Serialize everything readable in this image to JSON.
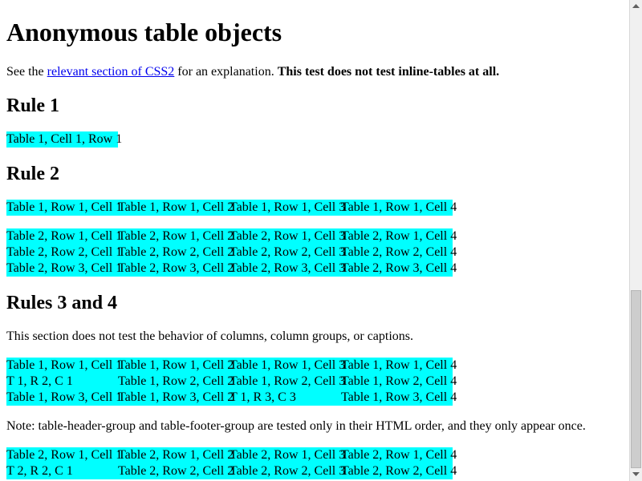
{
  "page": {
    "title": "Anonymous table objects",
    "intro": {
      "prefix": "See the ",
      "link": "relevant section of CSS2",
      "middle": " for an explanation. ",
      "bold": "This test does not test inline-tables at all."
    }
  },
  "rule1": {
    "heading": "Rule 1",
    "table": [
      "Table 1, Cell 1, Row 1"
    ]
  },
  "rule2": {
    "heading": "Rule 2",
    "table1": [
      [
        "Table 1, Row 1, Cell 1",
        "Table 1, Row 1, Cell 2",
        "Table 1, Row 1, Cell 3",
        "Table 1, Row 1, Cell 4"
      ]
    ],
    "table2": [
      [
        "Table 2, Row 1, Cell 1",
        "Table 2, Row 1, Cell 2",
        "Table 2, Row 1, Cell 3",
        "Table 2, Row 1, Cell 4"
      ],
      [
        "Table 2, Row 2, Cell 1",
        "Table 2, Row 2, Cell 2",
        "Table 2, Row 2, Cell 3",
        "Table 2, Row 2, Cell 4"
      ],
      [
        "Table 2, Row 3, Cell 1",
        "Table 2, Row 3, Cell 2",
        "Table 2, Row 3, Cell 3",
        "Table 2, Row 3, Cell 4"
      ]
    ]
  },
  "rules34": {
    "heading": "Rules 3 and 4",
    "description": "This section does not test the behavior of columns, column groups, or captions.",
    "table1": [
      [
        "Table 1, Row 1, Cell 1",
        "Table 1, Row 1, Cell 2",
        "Table 1, Row 1, Cell 3",
        "Table 1, Row 1, Cell 4"
      ],
      [
        "T 1, R 2, C 1",
        "Table 1, Row 2, Cell 2",
        "Table 1, Row 2, Cell 3",
        "Table 1, Row 2, Cell 4"
      ],
      [
        "Table 1, Row 3, Cell 1",
        "Table 1, Row 3, Cell 2",
        "T 1, R 3, C 3",
        "Table 1, Row 3, Cell 4"
      ]
    ],
    "note": "Note: table-header-group and table-footer-group are tested only in their HTML order, and they only appear once.",
    "table2": [
      [
        "Table 2, Row 1, Cell 1",
        "Table 2, Row 1, Cell 2",
        "Table 2, Row 1, Cell 3",
        "Table 2, Row 1, Cell 4"
      ],
      [
        "T 2, R 2, C 1",
        "Table 2, Row 2, Cell 2",
        "Table 2, Row 2, Cell 3",
        "Table 2, Row 2, Cell 4"
      ]
    ]
  },
  "colors": {
    "table_bg": "#00ffff",
    "link": "#0000ee"
  }
}
